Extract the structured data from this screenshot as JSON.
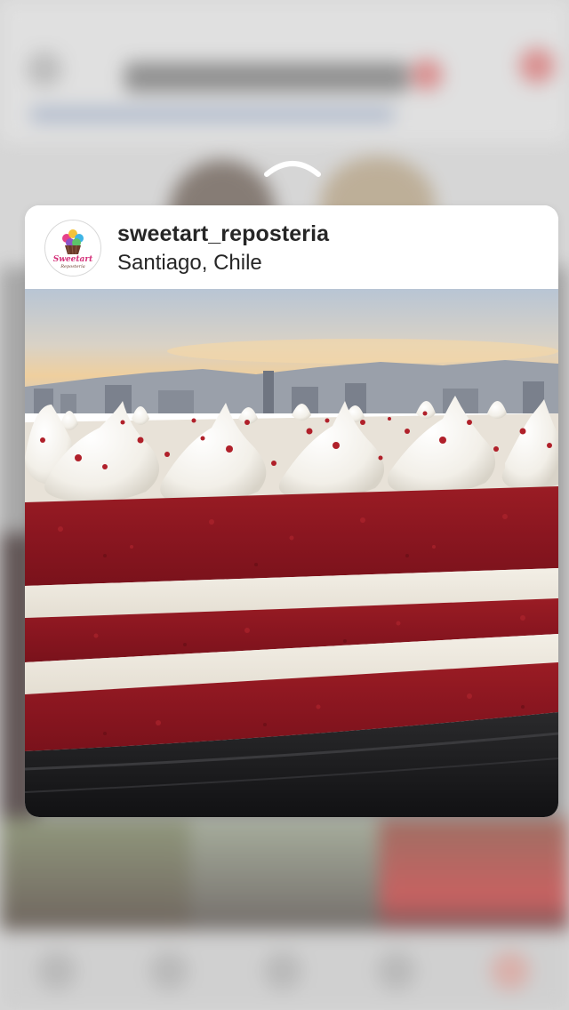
{
  "post": {
    "username": "sweetart_reposteria",
    "location": "Santiago, Chile",
    "avatar_logo_text": "Sweetart",
    "avatar_logo_subtext": "Repostería",
    "photo_subject": "red-velvet-cake"
  },
  "colors": {
    "text_primary": "#262626",
    "card_bg": "#ffffff",
    "cake_red": "#8e1a22",
    "frosting": "#f4f1ea"
  },
  "icons": {
    "swipe_up": "chevron-up-icon"
  }
}
